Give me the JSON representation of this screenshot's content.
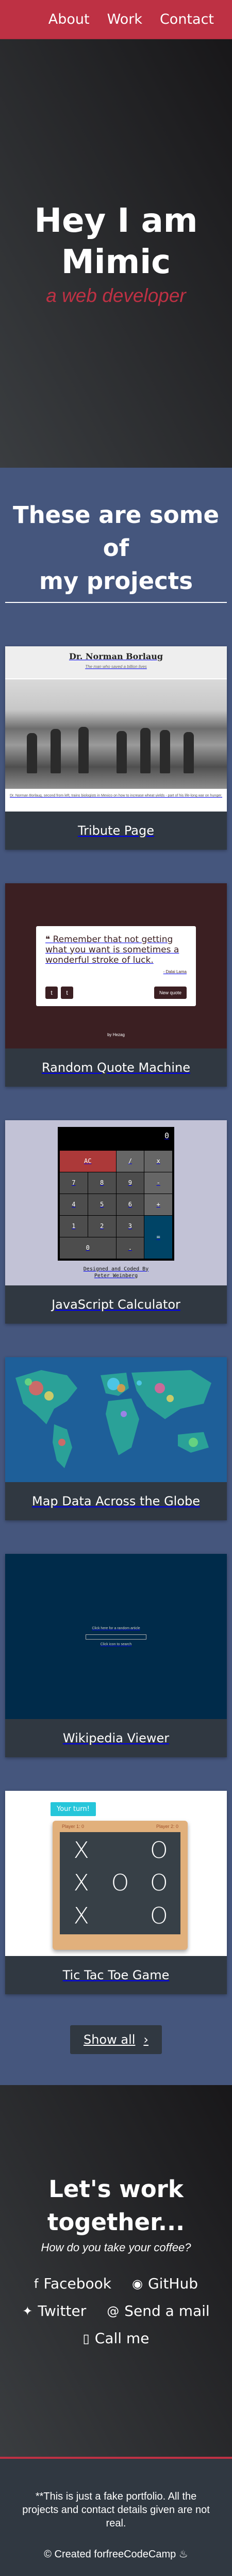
{
  "nav": {
    "about": "About",
    "work": "Work",
    "contact": "Contact"
  },
  "hero": {
    "title_line1": "Hey I am",
    "title_line2": "Mimic",
    "subtitle": "a web developer"
  },
  "projects": {
    "heading_line1": "These are some of",
    "heading_line2": "my projects",
    "items": [
      {
        "title": "Tribute Page"
      },
      {
        "title": "Random Quote Machine"
      },
      {
        "title": "JavaScript Calculator"
      },
      {
        "title": "Map Data Across the Globe"
      },
      {
        "title": "Wikipedia Viewer"
      },
      {
        "title": "Tic Tac Toe Game"
      }
    ],
    "tribute": {
      "name": "Dr. Norman Borlaug",
      "tagline": "The man who saved a billion lives",
      "caption": "Dr. Norman Borlaug, second from left, trains biologists in Mexico on how to increase wheat yields - part of his life-long war on hunger."
    },
    "quote": {
      "text": "Remember that not getting what you want is sometimes a wonderful stroke of luck.",
      "author": "- Dalai Lama",
      "button": "New quote",
      "by": "by Hezag"
    },
    "calc": {
      "display": "0",
      "keys": [
        "AC",
        "/",
        "x",
        "7",
        "8",
        "9",
        "-",
        "4",
        "5",
        "6",
        "+",
        "1",
        "2",
        "3",
        "=",
        "0",
        "."
      ],
      "note_line1": "Designed and Coded By",
      "note_line2": "Peter Weinberg"
    },
    "wiki": {
      "label": "Click here for a random article",
      "hint": "Click icon to search"
    },
    "ttt": {
      "turn": "Your turn!",
      "player_left": "Player 1: 0",
      "player_right": "Player 2: 0",
      "cells": [
        "X",
        "",
        "O",
        "X",
        "O",
        "O",
        "X",
        "",
        "O"
      ]
    },
    "show_all": "Show all"
  },
  "contact": {
    "heading_line1": "Let's work",
    "heading_line2": "together...",
    "subtitle": "How do you take your coffee?",
    "links": [
      {
        "label": "Facebook",
        "icon": "facebook-icon"
      },
      {
        "label": "GitHub",
        "icon": "github-icon"
      },
      {
        "label": "Twitter",
        "icon": "twitter-icon"
      },
      {
        "label": "Send a mail",
        "icon": "at-icon"
      },
      {
        "label": "Call me",
        "icon": "phone-icon"
      }
    ]
  },
  "footer": {
    "disclaimer": "**This is just a fake portfolio. All the projects and contact details given are not real.",
    "credit": "© Created forfreeCodeCamp"
  },
  "colors": {
    "accent": "#be3144",
    "projects_bg": "#45567d",
    "dark": "#303841"
  }
}
